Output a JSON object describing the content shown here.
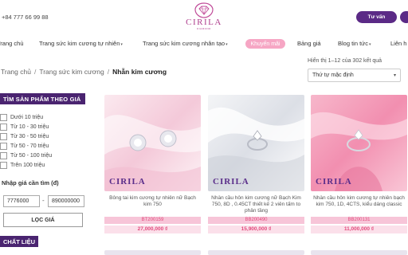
{
  "header": {
    "phone": "+84 777 66 99 88",
    "logo_text": "CIRILA",
    "logo_sub": "DIAMOND",
    "consult_label": "Tư vấn"
  },
  "nav": {
    "items": [
      "Trang chủ",
      "Trang sức kim cương tự nhiên",
      "Trang sức kim cương nhân tạo",
      "Khuyến mãi",
      "Bảng giá",
      "Blog tin tức",
      "Liên h"
    ]
  },
  "breadcrumb": {
    "home": "Trang chủ",
    "category": "Trang sức kim cương",
    "current": "Nhẫn kim cương"
  },
  "results": {
    "count_text": "Hiển thị 1–12 của 302 kết quả",
    "sort_value": "Thứ tự mặc định"
  },
  "sidebar": {
    "price_heading": "TÌM SẢN PHẨM THEO GIÁ",
    "price_options": [
      "Dưới 10 triệu",
      "Từ 10 - 30 triệu",
      "Từ 30 - 50 triệu",
      "Từ 50 - 70 triệu",
      "Từ 50 - 100 triệu",
      "Trên 100 triệu"
    ],
    "price_input_label": "Nhập giá cần tìm (đ)",
    "price_from": "7776000",
    "price_to": "890000000",
    "filter_button": "LỌC GIÁ",
    "material_heading": "CHẤT LIỆU"
  },
  "products": [
    {
      "brand": "CIRILA",
      "name": "Bông tai kim cương tự nhiên nữ Bạch kim 750",
      "code": "BT200159",
      "price": "27,000,000 ₫"
    },
    {
      "brand": "CIRILA",
      "name": "Nhẫn cầu hôn kim cương nữ Bạch Kim 750, 8D , 0.45CT thiết kế 2 viên tấm to phân tầng",
      "code": "BB200490",
      "price": "15,900,000 ₫"
    },
    {
      "brand": "CIRILA",
      "name": "Nhẫn cầu hôn kim cương tự nhiên bạch kim 750, 1D, 4CTS, kiểu dáng classic",
      "code": "BB200131",
      "price": "11,000,000 ₫"
    }
  ],
  "colors": {
    "brand_purple": "#5b2a86",
    "sidebar_heading": "#4a2470",
    "promo_pink": "#f6a6c4",
    "price_pink": "#e24b7d"
  }
}
